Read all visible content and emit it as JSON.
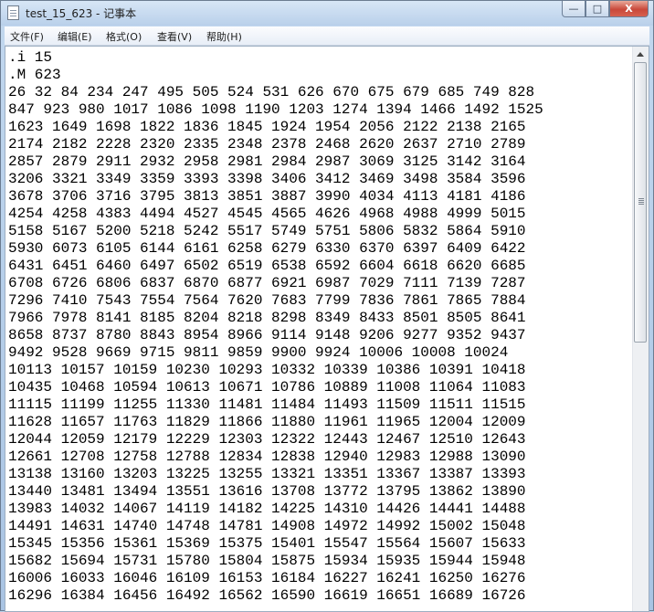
{
  "window": {
    "title": "test_15_623 - 记事本",
    "buttons": {
      "minimize": "—",
      "maximize": "□",
      "close": "X"
    }
  },
  "menu": [
    "文件(F)",
    "编辑(E)",
    "格式(O)",
    "查看(V)",
    "帮助(H)"
  ],
  "editor": {
    "content": ".i 15\n.M 623\n26 32 84 234 247 495 505 524 531 626 670 675 679 685 749 828\n847 923 980 1017 1086 1098 1190 1203 1274 1394 1466 1492 1525\n1623 1649 1698 1822 1836 1845 1924 1954 2056 2122 2138 2165\n2174 2182 2228 2320 2335 2348 2378 2468 2620 2637 2710 2789\n2857 2879 2911 2932 2958 2981 2984 2987 3069 3125 3142 3164\n3206 3321 3349 3359 3393 3398 3406 3412 3469 3498 3584 3596\n3678 3706 3716 3795 3813 3851 3887 3990 4034 4113 4181 4186\n4254 4258 4383 4494 4527 4545 4565 4626 4968 4988 4999 5015\n5158 5167 5200 5218 5242 5517 5749 5751 5806 5832 5864 5910\n5930 6073 6105 6144 6161 6258 6279 6330 6370 6397 6409 6422\n6431 6451 6460 6497 6502 6519 6538 6592 6604 6618 6620 6685\n6708 6726 6806 6837 6870 6877 6921 6987 7029 7111 7139 7287\n7296 7410 7543 7554 7564 7620 7683 7799 7836 7861 7865 7884\n7966 7978 8141 8185 8204 8218 8298 8349 8433 8501 8505 8641\n8658 8737 8780 8843 8954 8966 9114 9148 9206 9277 9352 9437\n9492 9528 9669 9715 9811 9859 9900 9924 10006 10008 10024\n10113 10157 10159 10230 10293 10332 10339 10386 10391 10418\n10435 10468 10594 10613 10671 10786 10889 11008 11064 11083\n11115 11199 11255 11330 11481 11484 11493 11509 11511 11515\n11628 11657 11763 11829 11866 11880 11961 11965 12004 12009\n12044 12059 12179 12229 12303 12322 12443 12467 12510 12643\n12661 12708 12758 12788 12834 12838 12940 12983 12988 13090\n13138 13160 13203 13225 13255 13321 13351 13367 13387 13393\n13440 13481 13494 13551 13616 13708 13772 13795 13862 13890\n13983 14032 14067 14119 14182 14225 14310 14426 14441 14488\n14491 14631 14740 14748 14781 14908 14972 14992 15002 15048\n15345 15356 15361 15369 15375 15401 15547 15564 15607 15633\n15682 15694 15731 15780 15804 15875 15934 15935 15944 15948\n16006 16033 16046 16109 16153 16184 16227 16241 16250 16276\n16296 16384 16456 16492 16562 16590 16619 16651 16689 16726"
  },
  "scrollbar": {
    "position_fraction": 0.0
  }
}
